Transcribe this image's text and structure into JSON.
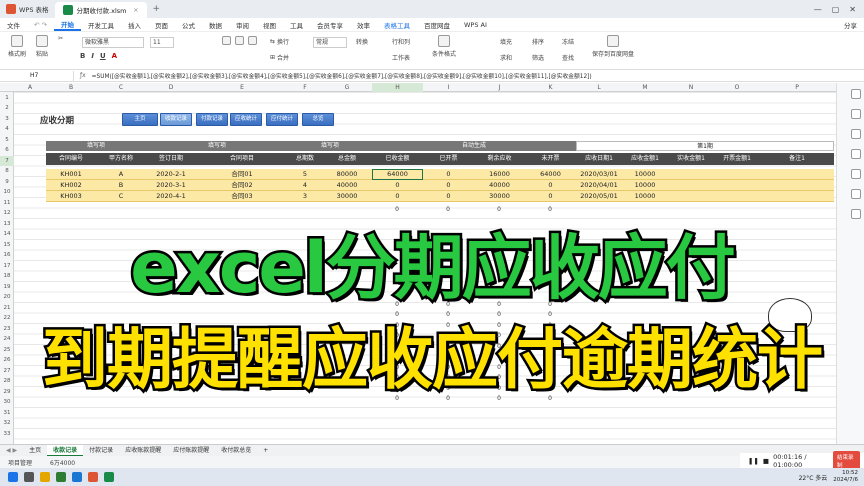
{
  "app": {
    "name": "WPS 表格",
    "file": "分期收付款.xlsm"
  },
  "menu": [
    "文件",
    "开始",
    "开发工具",
    "插入",
    "页面",
    "公式",
    "数据",
    "审阅",
    "视图",
    "工具",
    "会员专享",
    "效率",
    "表格工具",
    "百度网盘",
    "WPS AI"
  ],
  "menu_active": "开始",
  "top_right": {
    "share": "分享"
  },
  "ribbon": {
    "format_painter": "格式刷",
    "paste": "粘贴",
    "cut": "剪切",
    "copy": "复制",
    "font": "微软雅黑",
    "size": "11",
    "wrap": "换行",
    "merge": "合并",
    "number_format": "常规",
    "convert": "转换",
    "row_col": "行和列",
    "worksheet": "工作表",
    "cond_format": "条件格式",
    "fill": "填充",
    "sort": "排序",
    "freeze": "冻结",
    "sum": "求和",
    "filter": "筛选",
    "find": "查找",
    "save_cloud": "保存到百度网盘"
  },
  "formula_bar": {
    "cell": "H7",
    "formula": "=SUM([@实收金额1],[@实收金额2],[@实收金额3],[@实收金额4],[@实收金额5],[@实收金额6],[@实收金额7],[@实收金额8],[@实收金额9],[@实收金额10],[@实收金额11],[@实收金额12])"
  },
  "columns": [
    "A",
    "B",
    "C",
    "D",
    "E",
    "F",
    "G",
    "H",
    "I",
    "J",
    "K",
    "L",
    "M",
    "N",
    "O",
    "P"
  ],
  "rows": [
    "1",
    "2",
    "3",
    "4",
    "5",
    "6",
    "7",
    "8",
    "9",
    "10",
    "11",
    "12",
    "13",
    "14",
    "15",
    "16",
    "17",
    "18",
    "19",
    "20",
    "21",
    "22",
    "23",
    "24",
    "25",
    "26",
    "27",
    "28",
    "29",
    "30",
    "31",
    "32",
    "33"
  ],
  "sheet": {
    "title": "应收分期",
    "nav_buttons": [
      "主页",
      "收款记录",
      "付款记录",
      "应收统计",
      "应付统计",
      "总览"
    ],
    "nav_active": "收款记录",
    "group_headers": [
      "填写项",
      "填写项",
      "填写项",
      "自动生成",
      "第1期"
    ],
    "headers": [
      "合同编号",
      "甲方名称",
      "签订日期",
      "合同项目",
      "总期数",
      "总金额",
      "已收金额",
      "已开票",
      "剩余应收",
      "未开票",
      "应收日期1",
      "应收金额1",
      "实收金额1",
      "开票金额1",
      "备注1"
    ],
    "data_rows": [
      [
        "KH001",
        "A",
        "2020-2-1",
        "合同01",
        "5",
        "80000",
        "64000",
        "0",
        "16000",
        "64000",
        "2020/03/01",
        "10000"
      ],
      [
        "KH002",
        "B",
        "2020-3-1",
        "合同02",
        "4",
        "40000",
        "0",
        "0",
        "40000",
        "0",
        "2020/04/01",
        "10000"
      ],
      [
        "KH003",
        "C",
        "2020-4-1",
        "合同03",
        "3",
        "30000",
        "0",
        "0",
        "30000",
        "0",
        "2020/05/01",
        "10000"
      ]
    ],
    "zero": "0"
  },
  "sheet_tabs": [
    "主页",
    "收款记录",
    "付款记录",
    "应收账款提醒",
    "应付账款提醒",
    "收付款总览"
  ],
  "sheet_tab_active": "收款记录",
  "status": {
    "project": "项目管理",
    "count": "6万4000"
  },
  "player": {
    "time": "00:01:16 / 01:00:00",
    "finish": "结束录制"
  },
  "taskbar": {
    "weather": "22°C 多云",
    "time": "10:52",
    "date": "2024/7/6"
  },
  "overlay": {
    "line1": "excel分期应收应付",
    "line2": "到期提醒应收应付逾期统计"
  }
}
